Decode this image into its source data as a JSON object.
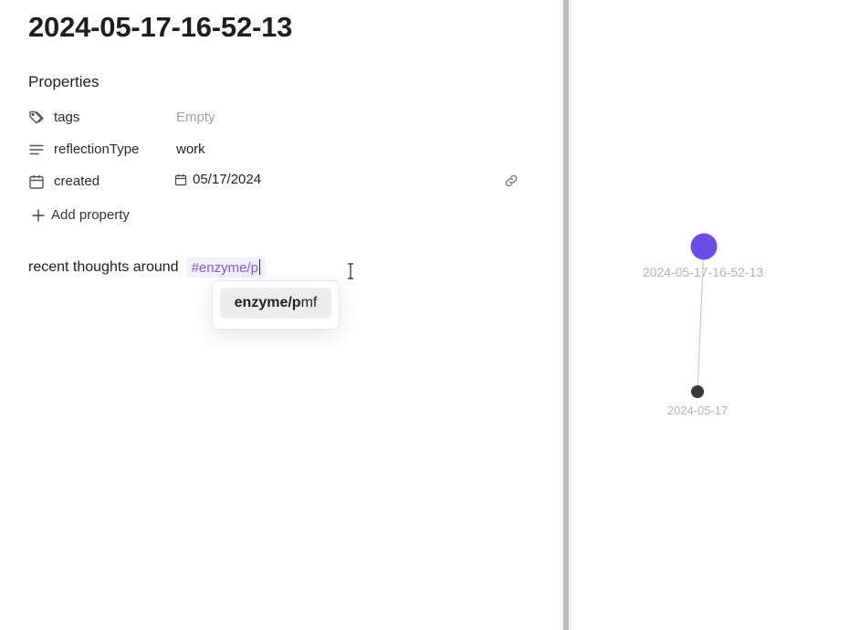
{
  "note": {
    "title": "2024-05-17-16-52-13",
    "properties_heading": "Properties",
    "properties": [
      {
        "key": "tags",
        "value": "Empty",
        "icon": "tags-icon"
      },
      {
        "key": "reflectionType",
        "value": "work",
        "icon": "text-lines-icon"
      },
      {
        "key": "created",
        "value": "05/17/2024",
        "icon": "calendar-icon"
      }
    ],
    "add_property_label": "Add property",
    "body_text": "recent thoughts around",
    "tag_input": "#enzyme/p"
  },
  "suggestion": {
    "match": "enzyme/p",
    "rest": "mf"
  },
  "graph": {
    "nodes": [
      {
        "label": "2024-05-17-16-52-13",
        "color": "#6c4ee6"
      },
      {
        "label": "2024-05-17",
        "color": "#3a3a3a"
      }
    ]
  },
  "colors": {
    "accent": "#6c4ee6",
    "tag_text": "#7b5cd6",
    "tag_bg": "#f2f0fb",
    "muted": "#a0a0a0"
  }
}
